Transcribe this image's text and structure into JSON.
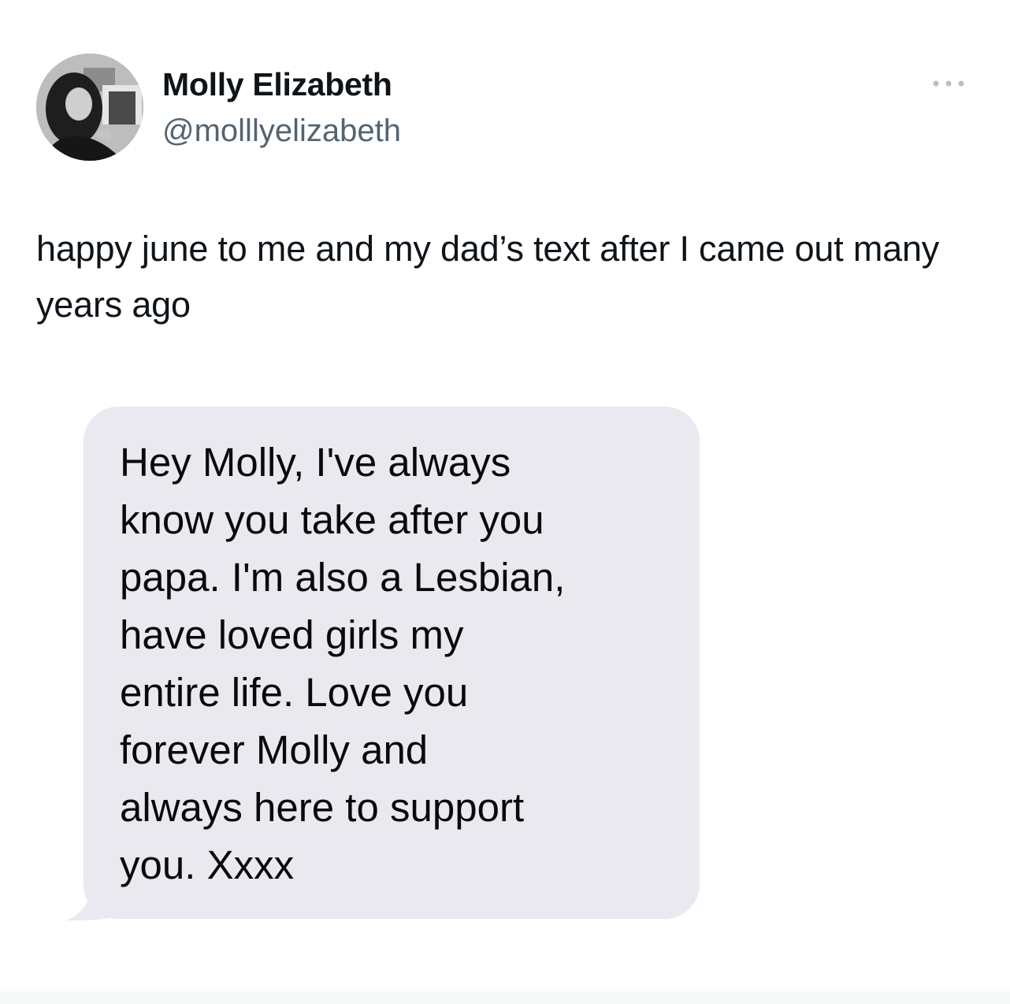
{
  "author": {
    "name": "Molly Elizabeth",
    "handle": "@molllyelizabeth",
    "avatar_icon": "profile-photo"
  },
  "more_icon": "more-dots-icon",
  "tweet": {
    "text": "happy june to me and my dad’s text after I came out many years ago"
  },
  "message_screenshot": {
    "text": "Hey Molly, I've always\nknow you take after you\npapa. I'm also a Lesbian,\nhave loved girls my\nentire life. Love you\nforever Molly and\nalways here to support\nyou. Xxxx",
    "bubble_color": "#e9e9ef"
  },
  "colors": {
    "text": "#0f1419",
    "secondary_text": "#536471"
  }
}
